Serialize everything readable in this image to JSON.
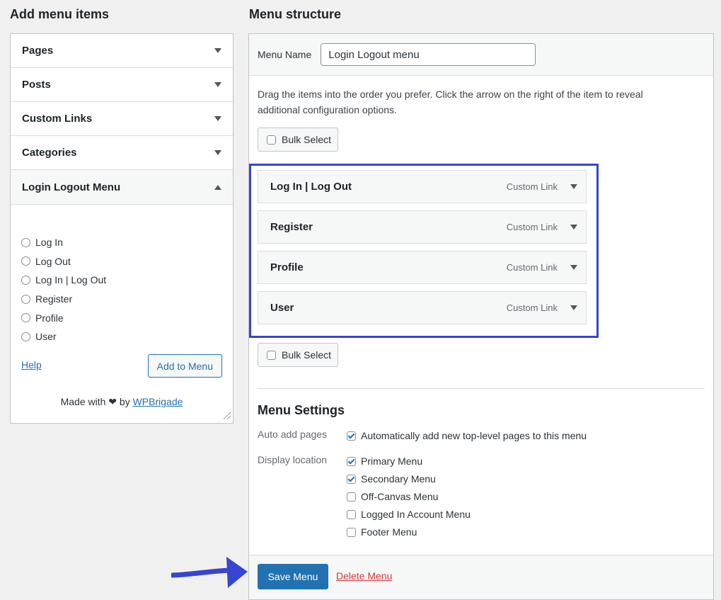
{
  "left": {
    "heading": "Add menu items",
    "sections": [
      "Pages",
      "Posts",
      "Custom Links",
      "Categories"
    ],
    "open_section": "Login Logout Menu",
    "items": [
      "Log In",
      "Log Out",
      "Log In | Log Out",
      "Register",
      "Profile",
      "User"
    ],
    "help_label": "Help",
    "add_button": "Add to Menu",
    "made_with": "Made with",
    "by": "by",
    "brand": "WPBrigade"
  },
  "right": {
    "heading": "Menu structure",
    "name_label": "Menu Name",
    "name_value": "Login Logout menu",
    "instructions": "Drag the items into the order you prefer. Click the arrow on the right of the item to reveal additional configuration options.",
    "bulk_select": "Bulk Select",
    "menu_items": [
      {
        "title": "Log In | Log Out",
        "type": "Custom Link"
      },
      {
        "title": "Register",
        "type": "Custom Link"
      },
      {
        "title": "Profile",
        "type": "Custom Link"
      },
      {
        "title": "User",
        "type": "Custom Link"
      }
    ],
    "settings": {
      "title": "Menu Settings",
      "auto_add_label": "Auto add pages",
      "auto_add_option": {
        "label": "Automatically add new top-level pages to this menu",
        "checked": true
      },
      "location_label": "Display location",
      "locations": [
        {
          "label": "Primary Menu",
          "checked": true
        },
        {
          "label": "Secondary Menu",
          "checked": true
        },
        {
          "label": "Off-Canvas Menu",
          "checked": false
        },
        {
          "label": "Logged In Account Menu",
          "checked": false
        },
        {
          "label": "Footer Menu",
          "checked": false
        }
      ]
    },
    "save_button": "Save Menu",
    "delete_link": "Delete Menu"
  },
  "colors": {
    "primary": "#2271b1",
    "highlight": "#3845d0",
    "danger": "#d63638"
  }
}
